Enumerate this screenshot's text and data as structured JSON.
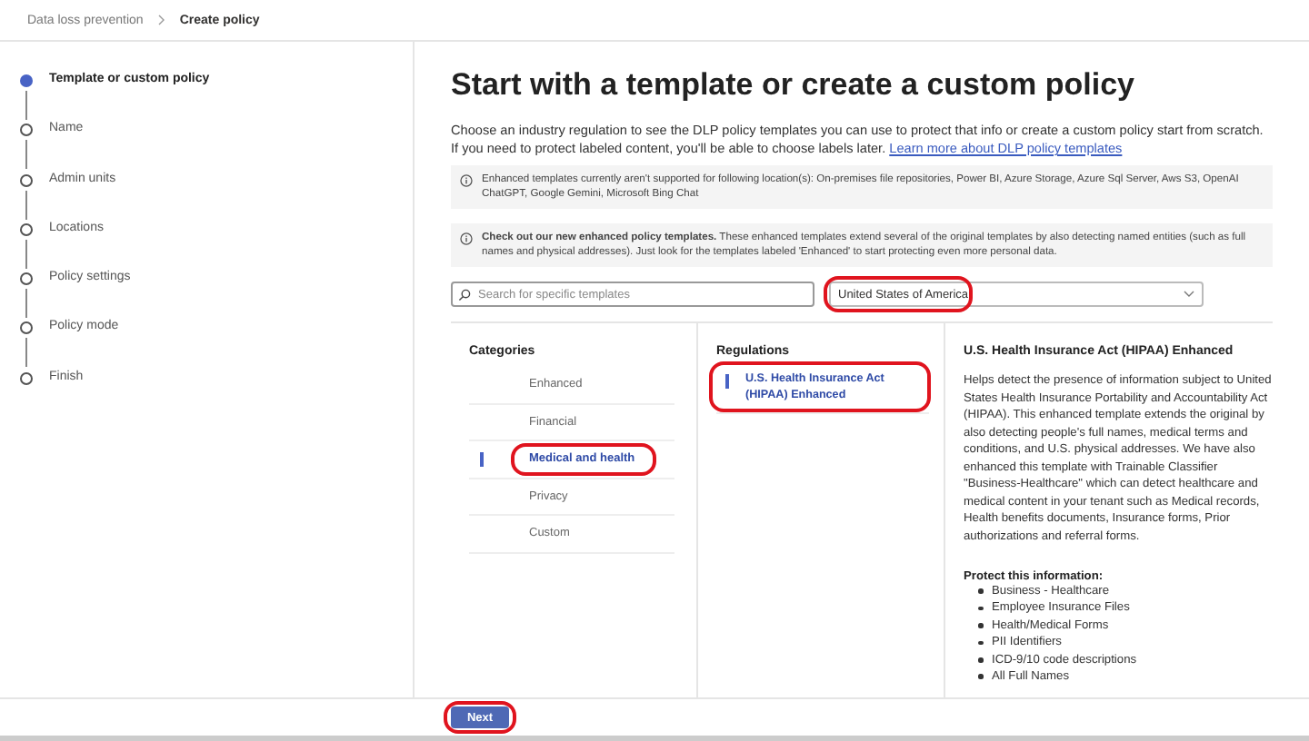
{
  "breadcrumb": [
    "Data loss prevention",
    "Create policy"
  ],
  "steps": [
    {
      "label": "Template or custom policy",
      "selected": true
    },
    {
      "label": "Name",
      "selected": false
    },
    {
      "label": "Admin units",
      "selected": false
    },
    {
      "label": "Locations",
      "selected": false
    },
    {
      "label": "Policy settings",
      "selected": false
    },
    {
      "label": "Policy mode",
      "selected": false
    },
    {
      "label": "Finish",
      "selected": false
    }
  ],
  "title": "Start with a template or create a custom policy",
  "description": "Choose an industry regulation to see the DLP policy templates you can use to protect that info or create a custom policy start from scratch. If you need to protect labeled content, you'll be able to choose labels later.",
  "learn_more_link": "Learn more about DLP policy templates",
  "notices": [
    "Enhanced templates currently aren't supported for following location(s): On-premises file repositories, Power BI, Azure Storage, Azure Sql Server, Aws S3, OpenAI ChatGPT, Google Gemini, Microsoft Bing Chat",
    "**Check out our new enhanced policy templates.** These enhanced templates extend several of the original templates by also detecting named entities (such as full names and physical addresses). Just look for the templates labeled 'Enhanced' to start protecting even more personal data."
  ],
  "search": {
    "placeholder": "Search for specific templates"
  },
  "country": {
    "value": "United States of America",
    "highlighted": true
  },
  "categories": {
    "heading": "Categories",
    "items": [
      {
        "label": "Enhanced",
        "selected": false,
        "highlighted": false
      },
      {
        "label": "Financial",
        "selected": false,
        "highlighted": false
      },
      {
        "label": "Medical and health",
        "selected": true,
        "highlighted": true
      },
      {
        "label": "Privacy",
        "selected": false,
        "highlighted": false
      },
      {
        "label": "Custom",
        "selected": false,
        "highlighted": false
      }
    ]
  },
  "regulations": {
    "heading": "Regulations",
    "items": [
      {
        "label": "U.S. Health Insurance Act (HIPAA) Enhanced",
        "selected": true,
        "highlighted": true
      }
    ]
  },
  "detail": {
    "title": "U.S. Health Insurance Act (HIPAA) Enhanced",
    "description": "Helps detect the presence of information subject to United States Health Insurance Portability and Accountability Act (HIPAA). This enhanced template extends the original by also detecting people's full names, medical terms and conditions, and U.S. physical addresses. We have also enhanced this template with Trainable Classifier \"Business-Healthcare\" which can detect healthcare and medical content in your tenant such as Medical records, Health benefits documents, Insurance forms, Prior authorizations and referral forms.",
    "protect_heading": "Protect this information:",
    "protect_items": [
      "Business - Healthcare",
      "Employee Insurance Files",
      "Health/Medical Forms",
      "PII Identifiers",
      "ICD-9/10 code descriptions",
      "All Full Names"
    ]
  },
  "next_button": {
    "label": "Next",
    "highlighted": true
  }
}
